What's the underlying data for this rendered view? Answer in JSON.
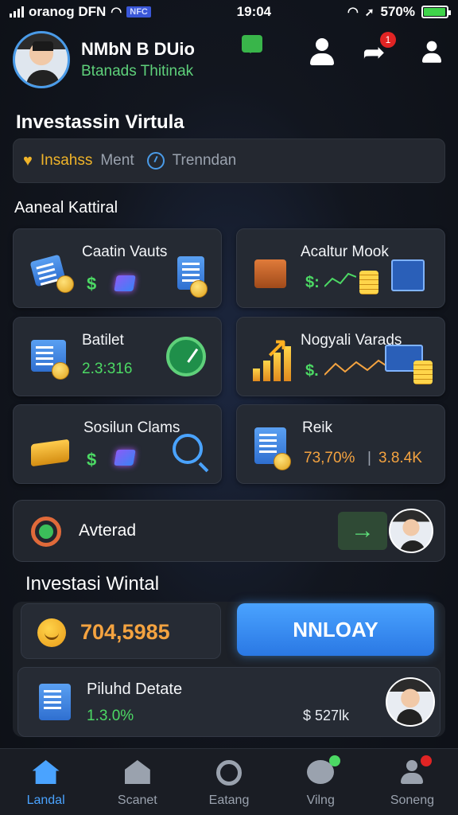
{
  "status_bar": {
    "carrier": "oranog DFN",
    "nfc": "NFC",
    "time": "19:04",
    "battery_text": "570%",
    "battery_level": 0.95
  },
  "header": {
    "name": "NMbN B DUio",
    "subtitle": "Btanads Thitinak",
    "notification_count": "1"
  },
  "section1_title": "Investassin Virtula",
  "filters": {
    "active": "Insahss",
    "items": [
      "Ment",
      "Trenndan"
    ]
  },
  "section2_title": "Aaneal Kattiral",
  "cards": [
    {
      "title": "Caatin Vauts"
    },
    {
      "title": "Acaltur Mook",
      "prefix": "$:"
    },
    {
      "title": "Batilet",
      "value": "2.3:316"
    },
    {
      "title": "Nogyali Varads",
      "prefix": "$."
    },
    {
      "title": "Sosilun Clams"
    },
    {
      "title": "Reik",
      "value": "73,70%",
      "value2": "3.8.4K"
    }
  ],
  "advert": {
    "label": "Avterad"
  },
  "section3_title": "Investasi Wintal",
  "wallet": {
    "balance": "704,5985",
    "cta": "NNLOAY",
    "row_title": "Piluhd Detate",
    "row_value": "1.3.0%",
    "row_amount": "527lk"
  },
  "tabs": [
    {
      "label": "Landal",
      "active": true
    },
    {
      "label": "Scanet"
    },
    {
      "label": "Eatang"
    },
    {
      "label": "Vilng"
    },
    {
      "label": "Soneng"
    }
  ],
  "colors": {
    "accent": "#4aa3ff",
    "positive": "#4cd964",
    "highlight": "#f4a340",
    "background": "#12161f"
  }
}
